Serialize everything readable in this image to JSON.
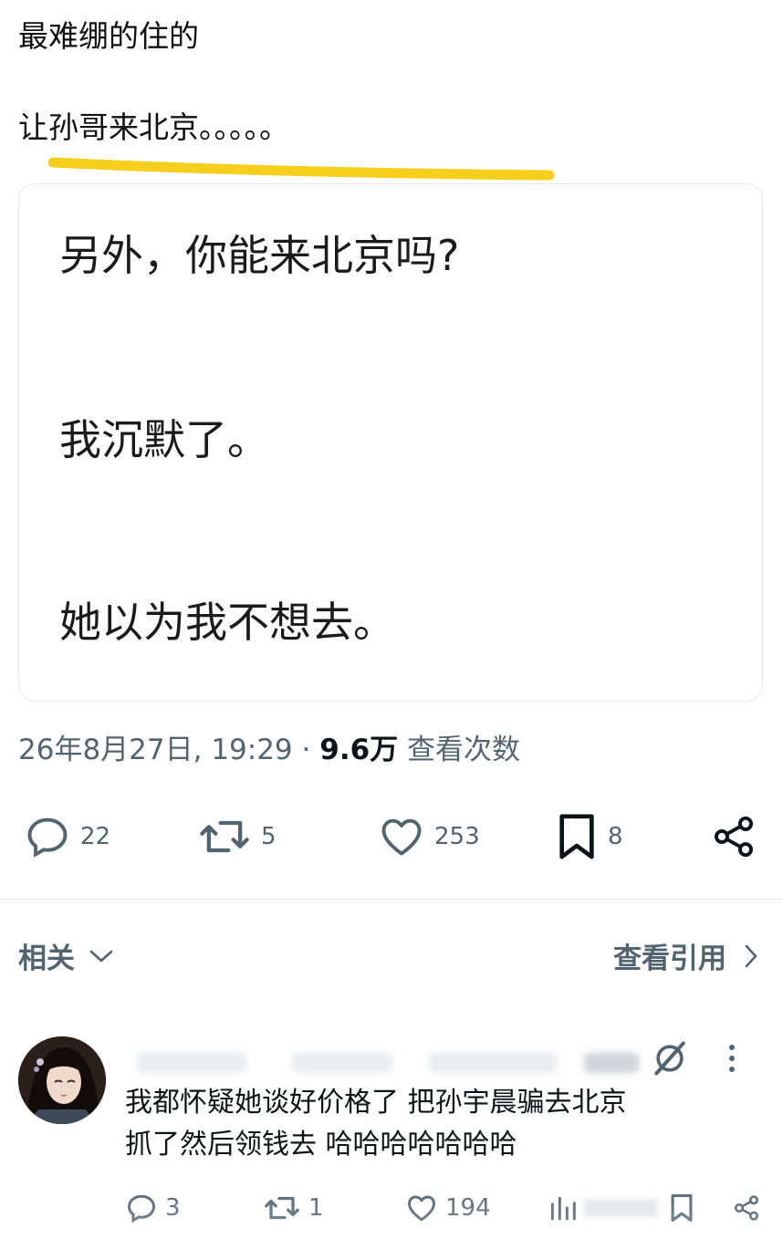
{
  "post": {
    "line1": "最难绷的住的",
    "line2": "让孙哥来北京。。。。。",
    "highlight_color": "#f5cf1b"
  },
  "quote_image": {
    "line1": "另外，你能来北京吗?",
    "line2": "我沉默了。",
    "line3": "她以为我不想去。"
  },
  "meta": {
    "timestamp": "26年8月27日, 19:29",
    "separator": "·",
    "views": "9.6万",
    "views_label": "查看次数"
  },
  "actions": {
    "replies": "22",
    "reposts": "5",
    "likes": "253",
    "bookmarks": "8",
    "reply_icon": "speech-bubble-icon",
    "repost_icon": "repost-arrows-icon",
    "like_icon": "heart-icon",
    "bookmark_icon": "bookmark-icon",
    "share_icon": "share-icon"
  },
  "related": {
    "label": "相关",
    "view_quotes": "查看引用"
  },
  "reply": {
    "text_line1": "我都怀疑她谈好价格了 把孙宇晨骗去北京",
    "text_line2": "抓了然后领钱去 哈哈哈哈哈哈哈",
    "replies": "3",
    "reposts": "1",
    "likes": "194"
  },
  "colors": {
    "text_primary": "#0f1419",
    "text_secondary": "#536471",
    "border": "#e6e8eb"
  }
}
